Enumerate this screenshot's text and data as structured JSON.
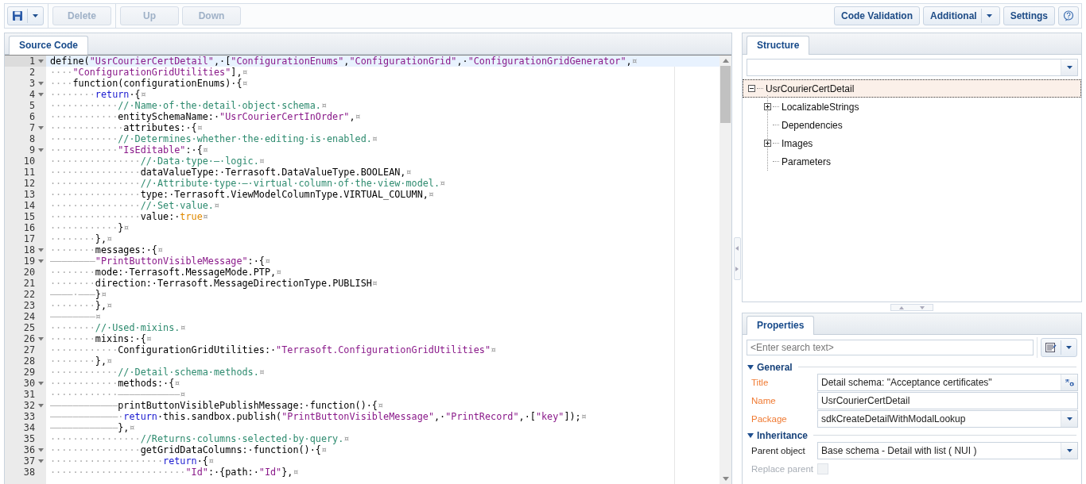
{
  "toolbar": {
    "left": [
      {
        "kind": "save",
        "disabled": false
      },
      {
        "kind": "text",
        "label": "Delete",
        "disabled": true
      },
      {
        "kind": "text",
        "label": "Up",
        "disabled": true
      },
      {
        "kind": "text",
        "label": "Down",
        "disabled": true
      }
    ],
    "right": [
      {
        "kind": "text",
        "label": "Code Validation",
        "disabled": false
      },
      {
        "kind": "split",
        "label": "Additional",
        "disabled": false
      },
      {
        "kind": "text",
        "label": "Settings",
        "disabled": false
      },
      {
        "kind": "help",
        "disabled": false
      }
    ]
  },
  "editor": {
    "tabs": [
      {
        "label": "Source Code",
        "selected": true
      }
    ],
    "lines": [
      {
        "number": "1",
        "foldable": true,
        "current": true,
        "tokens": [
          {
            "kind": "plain",
            "text": "define("
          },
          {
            "kind": "string",
            "text": "\"UsrCourierCertDetail\""
          },
          {
            "kind": "plain",
            "text": ",·["
          },
          {
            "kind": "string",
            "text": "\"ConfigurationEnums\""
          },
          {
            "kind": "plain",
            "text": ","
          },
          {
            "kind": "string",
            "text": "\"ConfigurationGrid\""
          },
          {
            "kind": "plain",
            "text": ",·"
          },
          {
            "kind": "string",
            "text": "\"ConfigurationGridGenerator\""
          },
          {
            "kind": "plain",
            "text": ","
          },
          {
            "kind": "eol",
            "text": "¤"
          }
        ]
      },
      {
        "number": "2",
        "foldable": false,
        "current": false,
        "tokens": [
          {
            "kind": "ws",
            "text": "····"
          },
          {
            "kind": "string",
            "text": "\"ConfigurationGridUtilities\""
          },
          {
            "kind": "plain",
            "text": "],"
          },
          {
            "kind": "eol",
            "text": "¤"
          }
        ]
      },
      {
        "number": "3",
        "foldable": true,
        "current": false,
        "tokens": [
          {
            "kind": "ws",
            "text": "····"
          },
          {
            "kind": "plain",
            "text": "function(configurationEnums)·{"
          },
          {
            "kind": "eol",
            "text": "¤"
          }
        ]
      },
      {
        "number": "4",
        "foldable": true,
        "current": false,
        "tokens": [
          {
            "kind": "ws",
            "text": "········"
          },
          {
            "kind": "keyword",
            "text": "return"
          },
          {
            "kind": "plain",
            "text": "·{"
          },
          {
            "kind": "eol",
            "text": "¤"
          }
        ]
      },
      {
        "number": "5",
        "foldable": false,
        "current": false,
        "tokens": [
          {
            "kind": "ws",
            "text": "············"
          },
          {
            "kind": "comment",
            "text": "//·Name·of·the·detail·object·schema."
          },
          {
            "kind": "eol",
            "text": "¤"
          }
        ]
      },
      {
        "number": "6",
        "foldable": false,
        "current": false,
        "tokens": [
          {
            "kind": "ws",
            "text": "············"
          },
          {
            "kind": "plain",
            "text": "entitySchemaName:·"
          },
          {
            "kind": "string",
            "text": "\"UsrCourierCertInOrder\""
          },
          {
            "kind": "plain",
            "text": ","
          },
          {
            "kind": "eol",
            "text": "¤"
          }
        ]
      },
      {
        "number": "7",
        "foldable": true,
        "current": false,
        "tokens": [
          {
            "kind": "ws",
            "text": "·············"
          },
          {
            "kind": "plain",
            "text": "attributes:·{"
          },
          {
            "kind": "eol",
            "text": "¤"
          }
        ]
      },
      {
        "number": "8",
        "foldable": false,
        "current": false,
        "tokens": [
          {
            "kind": "ws",
            "text": "············"
          },
          {
            "kind": "comment",
            "text": "//·Determines·whether·the·editing·is·enabled."
          },
          {
            "kind": "eol",
            "text": "¤"
          }
        ]
      },
      {
        "number": "9",
        "foldable": true,
        "current": false,
        "tokens": [
          {
            "kind": "ws",
            "text": "············"
          },
          {
            "kind": "string",
            "text": "\"IsEditable\""
          },
          {
            "kind": "plain",
            "text": ":·{"
          },
          {
            "kind": "eol",
            "text": "¤"
          }
        ]
      },
      {
        "number": "10",
        "foldable": false,
        "current": false,
        "tokens": [
          {
            "kind": "ws",
            "text": "················"
          },
          {
            "kind": "comment",
            "text": "//·Data·type·—·logic."
          },
          {
            "kind": "eol",
            "text": "¤"
          }
        ]
      },
      {
        "number": "11",
        "foldable": false,
        "current": false,
        "tokens": [
          {
            "kind": "ws",
            "text": "················"
          },
          {
            "kind": "plain",
            "text": "dataValueType:·Terrasoft.DataValueType.BOOLEAN,"
          },
          {
            "kind": "eol",
            "text": "¤"
          }
        ]
      },
      {
        "number": "12",
        "foldable": false,
        "current": false,
        "tokens": [
          {
            "kind": "ws",
            "text": "················"
          },
          {
            "kind": "comment",
            "text": "//·Attribute·type·—·virtual·column·of·the·view·model."
          },
          {
            "kind": "eol",
            "text": "¤"
          }
        ]
      },
      {
        "number": "13",
        "foldable": false,
        "current": false,
        "tokens": [
          {
            "kind": "ws",
            "text": "················"
          },
          {
            "kind": "plain",
            "text": "type:·Terrasoft.ViewModelColumnType.VIRTUAL_COLUMN,"
          },
          {
            "kind": "eol",
            "text": "¤"
          }
        ]
      },
      {
        "number": "14",
        "foldable": false,
        "current": false,
        "tokens": [
          {
            "kind": "ws",
            "text": "················"
          },
          {
            "kind": "comment",
            "text": "//·Set·value."
          },
          {
            "kind": "eol",
            "text": "¤"
          }
        ]
      },
      {
        "number": "15",
        "foldable": false,
        "current": false,
        "tokens": [
          {
            "kind": "ws",
            "text": "················"
          },
          {
            "kind": "plain",
            "text": "value:·"
          },
          {
            "kind": "bool",
            "text": "true"
          },
          {
            "kind": "eol",
            "text": "¤"
          }
        ]
      },
      {
        "number": "16",
        "foldable": false,
        "current": false,
        "tokens": [
          {
            "kind": "ws",
            "text": "············"
          },
          {
            "kind": "plain",
            "text": "}"
          },
          {
            "kind": "eol",
            "text": "¤"
          }
        ]
      },
      {
        "number": "17",
        "foldable": false,
        "current": false,
        "tokens": [
          {
            "kind": "ws",
            "text": "········"
          },
          {
            "kind": "plain",
            "text": "},"
          },
          {
            "kind": "eol",
            "text": "¤"
          }
        ]
      },
      {
        "number": "18",
        "foldable": true,
        "current": false,
        "tokens": [
          {
            "kind": "ws",
            "text": "········"
          },
          {
            "kind": "plain",
            "text": "messages:·{"
          },
          {
            "kind": "eol",
            "text": "¤"
          }
        ]
      },
      {
        "number": "19",
        "foldable": true,
        "current": false,
        "tokens": [
          {
            "kind": "ws",
            "text": "————————"
          },
          {
            "kind": "string",
            "text": "\"PrintButtonVisibleMessage\""
          },
          {
            "kind": "plain",
            "text": ":·{"
          },
          {
            "kind": "eol",
            "text": "¤"
          }
        ]
      },
      {
        "number": "20",
        "foldable": false,
        "current": false,
        "tokens": [
          {
            "kind": "ws",
            "text": "········"
          },
          {
            "kind": "plain",
            "text": "mode:·Terrasoft.MessageMode.PTP,"
          },
          {
            "kind": "eol",
            "text": "¤"
          }
        ]
      },
      {
        "number": "21",
        "foldable": false,
        "current": false,
        "tokens": [
          {
            "kind": "ws",
            "text": "········"
          },
          {
            "kind": "plain",
            "text": "direction:·Terrasoft.MessageDirectionType.PUBLISH"
          },
          {
            "kind": "eol",
            "text": "¤"
          }
        ]
      },
      {
        "number": "22",
        "foldable": false,
        "current": false,
        "tokens": [
          {
            "kind": "ws",
            "text": "————·———"
          },
          {
            "kind": "plain",
            "text": "}"
          },
          {
            "kind": "eol",
            "text": "¤"
          }
        ]
      },
      {
        "number": "23",
        "foldable": false,
        "current": false,
        "tokens": [
          {
            "kind": "ws",
            "text": "········"
          },
          {
            "kind": "plain",
            "text": "},"
          },
          {
            "kind": "eol",
            "text": "¤"
          }
        ]
      },
      {
        "number": "24",
        "foldable": false,
        "current": false,
        "tokens": [
          {
            "kind": "ws",
            "text": "————————"
          },
          {
            "kind": "eol",
            "text": "¤"
          }
        ]
      },
      {
        "number": "25",
        "foldable": false,
        "current": false,
        "tokens": [
          {
            "kind": "ws",
            "text": "········"
          },
          {
            "kind": "comment",
            "text": "//·Used·mixins."
          },
          {
            "kind": "eol",
            "text": "¤"
          }
        ]
      },
      {
        "number": "26",
        "foldable": true,
        "current": false,
        "tokens": [
          {
            "kind": "ws",
            "text": "········"
          },
          {
            "kind": "plain",
            "text": "mixins:·{"
          },
          {
            "kind": "eol",
            "text": "¤"
          }
        ]
      },
      {
        "number": "27",
        "foldable": false,
        "current": false,
        "tokens": [
          {
            "kind": "ws",
            "text": "············"
          },
          {
            "kind": "plain",
            "text": "ConfigurationGridUtilities:·"
          },
          {
            "kind": "string",
            "text": "\"Terrasoft.ConfigurationGridUtilities\""
          },
          {
            "kind": "eol",
            "text": "¤"
          }
        ]
      },
      {
        "number": "28",
        "foldable": false,
        "current": false,
        "tokens": [
          {
            "kind": "ws",
            "text": "········"
          },
          {
            "kind": "plain",
            "text": "},"
          },
          {
            "kind": "eol",
            "text": "¤"
          }
        ]
      },
      {
        "number": "29",
        "foldable": false,
        "current": false,
        "tokens": [
          {
            "kind": "ws",
            "text": "············"
          },
          {
            "kind": "comment",
            "text": "//·Detail·schema·methods."
          },
          {
            "kind": "eol",
            "text": "¤"
          }
        ]
      },
      {
        "number": "30",
        "foldable": true,
        "current": false,
        "tokens": [
          {
            "kind": "ws",
            "text": "············"
          },
          {
            "kind": "plain",
            "text": "methods:·{"
          },
          {
            "kind": "eol",
            "text": "¤"
          }
        ]
      },
      {
        "number": "31",
        "foldable": false,
        "current": false,
        "tokens": [
          {
            "kind": "ws",
            "text": "············———————————"
          },
          {
            "kind": "eol",
            "text": "¤"
          }
        ]
      },
      {
        "number": "32",
        "foldable": true,
        "current": false,
        "tokens": [
          {
            "kind": "ws",
            "text": "————————————"
          },
          {
            "kind": "plain",
            "text": "printButtonVisiblePublishMessage:·function()·{"
          },
          {
            "kind": "eol",
            "text": "¤"
          }
        ]
      },
      {
        "number": "33",
        "foldable": false,
        "current": false,
        "tokens": [
          {
            "kind": "ws",
            "text": "————————————·"
          },
          {
            "kind": "keyword",
            "text": "return"
          },
          {
            "kind": "plain",
            "text": "·this.sandbox.publish("
          },
          {
            "kind": "string",
            "text": "\"PrintButtonVisibleMessage\""
          },
          {
            "kind": "plain",
            "text": ",·"
          },
          {
            "kind": "string",
            "text": "\"PrintRecord\""
          },
          {
            "kind": "plain",
            "text": ",·["
          },
          {
            "kind": "string",
            "text": "\"key\""
          },
          {
            "kind": "plain",
            "text": "]);"
          },
          {
            "kind": "eol",
            "text": "¤"
          }
        ]
      },
      {
        "number": "34",
        "foldable": false,
        "current": false,
        "tokens": [
          {
            "kind": "ws",
            "text": "————————————"
          },
          {
            "kind": "plain",
            "text": "},"
          },
          {
            "kind": "eol",
            "text": "¤"
          }
        ]
      },
      {
        "number": "35",
        "foldable": false,
        "current": false,
        "tokens": [
          {
            "kind": "ws",
            "text": "················"
          },
          {
            "kind": "comment",
            "text": "//Returns·columns·selected·by·query."
          },
          {
            "kind": "eol",
            "text": "¤"
          }
        ]
      },
      {
        "number": "36",
        "foldable": true,
        "current": false,
        "tokens": [
          {
            "kind": "ws",
            "text": "················"
          },
          {
            "kind": "plain",
            "text": "getGridDataColumns:·function()·{"
          },
          {
            "kind": "eol",
            "text": "¤"
          }
        ]
      },
      {
        "number": "37",
        "foldable": true,
        "current": false,
        "tokens": [
          {
            "kind": "ws",
            "text": "····················"
          },
          {
            "kind": "keyword",
            "text": "return"
          },
          {
            "kind": "plain",
            "text": "·{"
          },
          {
            "kind": "eol",
            "text": "¤"
          }
        ]
      },
      {
        "number": "38",
        "foldable": false,
        "current": false,
        "tokens": [
          {
            "kind": "ws",
            "text": "························"
          },
          {
            "kind": "string",
            "text": "\"Id\""
          },
          {
            "kind": "plain",
            "text": ":·{path:·"
          },
          {
            "kind": "string",
            "text": "\"Id\""
          },
          {
            "kind": "plain",
            "text": "},"
          },
          {
            "kind": "eol",
            "text": "¤"
          }
        ]
      }
    ]
  },
  "structure": {
    "tabs": [
      {
        "label": "Structure",
        "selected": true
      }
    ],
    "tree": [
      {
        "label": "UsrCourierCertDetail",
        "selected": true,
        "expandable": true,
        "expanded": true,
        "children": [
          {
            "label": "LocalizableStrings",
            "selected": false,
            "expandable": true,
            "expanded": false
          },
          {
            "label": "Dependencies",
            "selected": false,
            "expandable": false
          },
          {
            "label": "Images",
            "selected": false,
            "expandable": true,
            "expanded": false
          },
          {
            "label": "Parameters",
            "selected": false,
            "expandable": false
          }
        ]
      }
    ]
  },
  "properties": {
    "tabs": [
      {
        "label": "Properties",
        "selected": true
      }
    ],
    "search": {
      "placeholder": "<Enter search text>"
    },
    "groups": [
      {
        "title": "General",
        "expanded": true,
        "fields": [
          {
            "label": "Title",
            "kind": "translatable",
            "required": true,
            "value": "Detail schema: \"Acceptance certificates\""
          },
          {
            "label": "Name",
            "kind": "text",
            "required": true,
            "value": "UsrCourierCertDetail"
          },
          {
            "label": "Package",
            "kind": "dropdown",
            "required": true,
            "value": "sdkCreateDetailWithModalLookup"
          }
        ]
      },
      {
        "title": "Inheritance",
        "expanded": true,
        "fields": [
          {
            "label": "Parent object",
            "kind": "dropdown",
            "required": false,
            "value": "Base schema - Detail with list ( NUI )"
          },
          {
            "label": "Replace parent",
            "kind": "checkbox",
            "required": false,
            "checked": false,
            "disabled": true
          }
        ]
      }
    ]
  }
}
